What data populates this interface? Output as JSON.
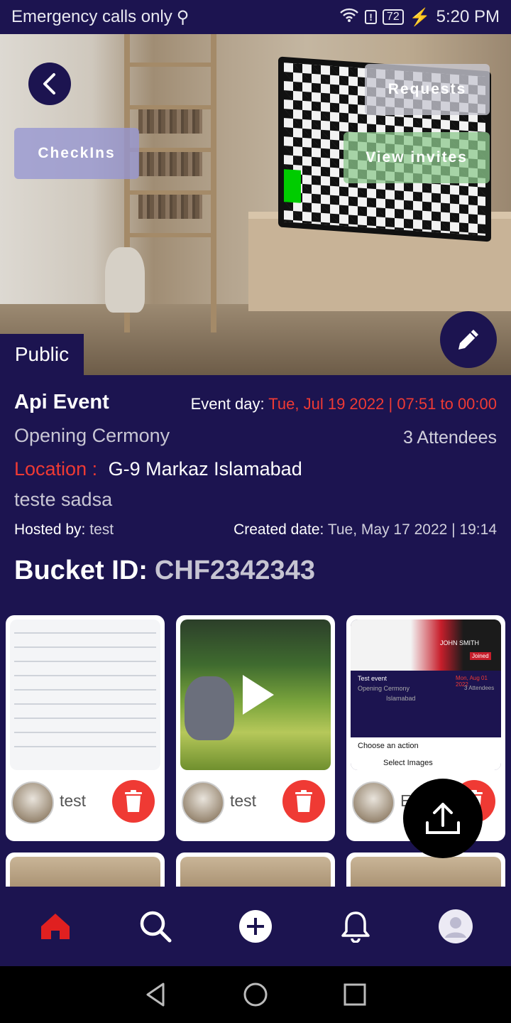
{
  "status_bar": {
    "left_text": "Emergency calls only",
    "battery": "72",
    "time": "5:20 PM"
  },
  "hero": {
    "requests_label": "Requests",
    "checkins_label": "CheckIns",
    "invites_label": "View invites",
    "visibility_badge": "Public"
  },
  "event": {
    "title": "Api Event",
    "day_label": "Event day:",
    "day_value": "Tue, Jul 19 2022 | 07:51 to 00:00",
    "subtitle": "Opening Cermony",
    "attendees": "3 Attendees",
    "location_label": "Location :",
    "location_value": "G-9 Markaz Islamabad",
    "description": "teste sadsa",
    "hosted_label": "Hosted by:",
    "hosted_value": "test",
    "created_label": "Created date:",
    "created_value": "Tue, May 17 2022 | 19:14",
    "bucket_label": "Bucket ID:",
    "bucket_value": "CHF2342343"
  },
  "media": [
    {
      "owner": "test",
      "type": "screenshot"
    },
    {
      "owner": "test",
      "type": "video"
    },
    {
      "owner": "Eh",
      "type": "screenshot",
      "inner_event": "Test event",
      "inner_date": "Mon, Aug 01 2022",
      "inner_sub": "Opening Cermony",
      "inner_att": "3 Attendees",
      "inner_loc": "Islamabad",
      "inner_action": "Choose an action",
      "inner_select": "Select Images",
      "inner_name": "JOHN SMITH",
      "inner_joined": "Joined"
    }
  ],
  "icons": {
    "back": "chevron-left-icon",
    "edit": "pencil-icon",
    "delete": "trash-icon",
    "upload": "upload-icon",
    "home": "home-icon",
    "search": "search-icon",
    "add": "add-circle-icon",
    "bell": "bell-icon",
    "profile": "profile-icon"
  },
  "colors": {
    "primary": "#1c1450",
    "accent_red": "#ef3a34",
    "nav_active": "#e02020"
  }
}
